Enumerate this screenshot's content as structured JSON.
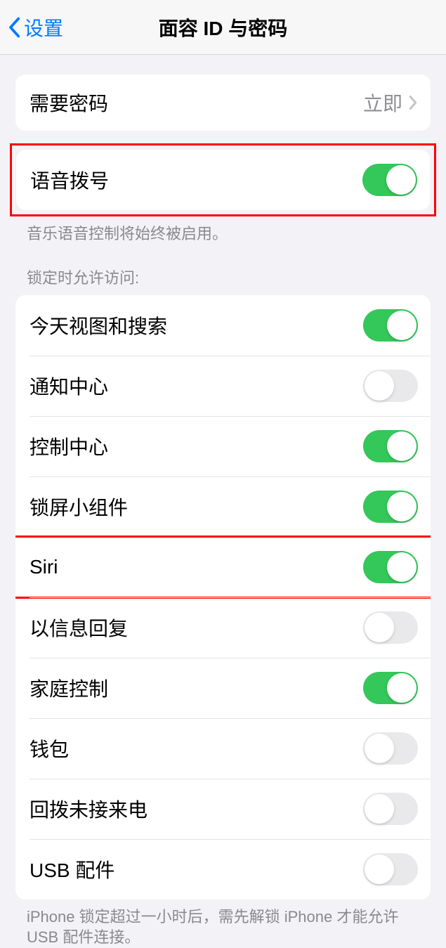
{
  "header": {
    "back_label": "设置",
    "title": "面容 ID 与密码"
  },
  "require_passcode": {
    "label": "需要密码",
    "value": "立即"
  },
  "voice_dial": {
    "label": "语音拨号",
    "enabled": true,
    "footer": "音乐语音控制将始终被启用。"
  },
  "lock_section": {
    "header": "锁定时允许访问:",
    "items": [
      {
        "label": "今天视图和搜索",
        "enabled": true
      },
      {
        "label": "通知中心",
        "enabled": false
      },
      {
        "label": "控制中心",
        "enabled": true
      },
      {
        "label": "锁屏小组件",
        "enabled": true
      },
      {
        "label": "Siri",
        "enabled": true
      },
      {
        "label": "以信息回复",
        "enabled": false
      },
      {
        "label": "家庭控制",
        "enabled": true
      },
      {
        "label": "钱包",
        "enabled": false
      },
      {
        "label": "回拨未接来电",
        "enabled": false
      },
      {
        "label": "USB 配件",
        "enabled": false
      }
    ],
    "footer": "iPhone 锁定超过一小时后，需先解锁 iPhone 才能允许 USB 配件连接。"
  }
}
